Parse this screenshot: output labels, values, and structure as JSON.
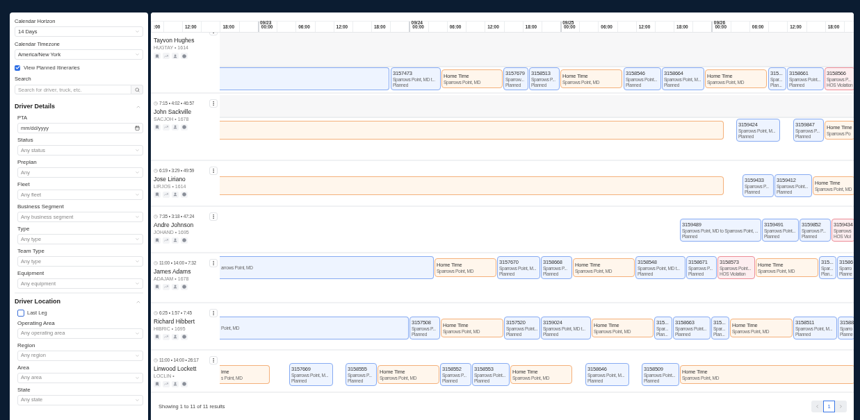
{
  "sidebar": {
    "calendar": [
      {
        "label": "Calendar Horizon",
        "value": "14 Days"
      },
      {
        "label": "Calendar Timezone",
        "value": "America/New York"
      }
    ],
    "view_planned": {
      "label": "View Planned Itineraries",
      "checked": true
    },
    "search": {
      "label": "Search",
      "placeholder": "Search for driver, truck, etc."
    },
    "sections": [
      {
        "title": "Driver Details",
        "expanded": true,
        "fields": [
          {
            "kind": "date",
            "label": "PTA",
            "placeholder": "mm/dd/yyyy"
          },
          {
            "kind": "select",
            "label": "Status",
            "placeholder": "Any status"
          },
          {
            "kind": "select",
            "label": "Preplan",
            "placeholder": "Any"
          },
          {
            "kind": "select",
            "label": "Fleet",
            "placeholder": "Any fleet"
          },
          {
            "kind": "select",
            "label": "Business Segment",
            "placeholder": "Any business segment"
          },
          {
            "kind": "select",
            "label": "Type",
            "placeholder": "Any type"
          },
          {
            "kind": "select",
            "label": "Team Type",
            "placeholder": "Any type"
          },
          {
            "kind": "select",
            "label": "Equipment",
            "placeholder": "Any equipment"
          }
        ]
      },
      {
        "title": "Driver Location",
        "expanded": true,
        "fields": [
          {
            "kind": "checkbox",
            "label": "Last Leg",
            "checked": false
          },
          {
            "kind": "select",
            "label": "Operating Area",
            "placeholder": "Any operating area"
          },
          {
            "kind": "select",
            "label": "Region",
            "placeholder": "Any region"
          },
          {
            "kind": "select",
            "label": "Area",
            "placeholder": "Any area"
          },
          {
            "kind": "select",
            "label": "State",
            "placeholder": "Any state"
          }
        ]
      }
    ]
  },
  "timeline": {
    "dates": [
      "09/23",
      "09/24",
      "09/25",
      "09/26"
    ],
    "hours": [
      ":00",
      "12:00",
      "18:00",
      "00:00",
      "06:00",
      "12:00",
      "18:00",
      "00:00",
      "06:00",
      "12:00",
      "18:00",
      "00:00",
      "06:00",
      "12:00",
      "18:00",
      "00:00",
      "06:00",
      "12:00",
      "18:00"
    ],
    "drivers": [
      {
        "name": "Tayvon Hughes",
        "code": "HUGTAY • 1614",
        "blocks": [
          {
            "kind": "trip"
          },
          {
            "kind": "trip",
            "title": "3157473",
            "detail": "Sparrows Point, MD t...",
            "status": "Planned"
          },
          {
            "kind": "home",
            "title": "Home Time",
            "detail": "Sparrows Point, MD"
          },
          {
            "kind": "trip",
            "title": "3157679",
            "detail": "Sparrow...",
            "status": "Planned"
          },
          {
            "kind": "trip",
            "title": "3158513",
            "detail": "Sparrows P...",
            "status": "Planned"
          },
          {
            "kind": "home",
            "title": "Home Time",
            "detail": "Sparrows Point, MD"
          },
          {
            "kind": "trip",
            "title": "3158546",
            "detail": "Sparrows Point...",
            "status": "Planned"
          },
          {
            "kind": "trip",
            "title": "3158664",
            "detail": "Sparrows Point, M...",
            "status": "Planned"
          },
          {
            "kind": "home",
            "title": "Home Time",
            "detail": "Sparrows Point, MD"
          },
          {
            "kind": "trip",
            "title": "315...",
            "detail": "Spar...",
            "status": "Plan..."
          },
          {
            "kind": "trip",
            "title": "3158661",
            "detail": "Sparrows Point...",
            "status": "Planned"
          },
          {
            "kind": "violation",
            "title": "3158566",
            "detail": "Sparrows P...",
            "status": "HOS Violation"
          }
        ]
      },
      {
        "name": "John Sackville",
        "code": "SACJOH • 1678",
        "meta": "7:15 • 4:02 • 46:57",
        "blocks": [
          {
            "kind": "home"
          },
          {
            "kind": "trip",
            "title": "3159424",
            "detail": "Sparrows Point, M...",
            "status": "Planned"
          },
          {
            "kind": "trip",
            "title": "3159847",
            "detail": "Sparrows P...",
            "status": "Planned"
          },
          {
            "kind": "home",
            "title": "Home Time",
            "detail": "Sparrows Po"
          }
        ]
      },
      {
        "name": "Jose Liriano",
        "code": "LIRJOS • 1614",
        "meta": "6:19 • 3:29 • 49:59",
        "blocks": [
          {
            "kind": "home"
          },
          {
            "kind": "trip",
            "title": "3159433",
            "detail": "Sparrows P...",
            "status": "Planned"
          },
          {
            "kind": "trip",
            "title": "3159412",
            "detail": "Sparrows Point...",
            "status": "Planned"
          },
          {
            "kind": "home",
            "title": "Home Time",
            "detail": "Sparrows Point, MD"
          }
        ]
      },
      {
        "name": "Andre Johnson",
        "code": "JOHAND • 1695",
        "meta": "7:35 • 3:18 • 47:24",
        "blocks": [
          {
            "kind": "trip",
            "title": "3159489",
            "detail": "Sparrows Point, MD to Sparrows Point, ...",
            "status": "Planned"
          },
          {
            "kind": "trip",
            "title": "3159491",
            "detail": "Sparrows Point...",
            "status": "Planned"
          },
          {
            "kind": "trip",
            "title": "3159852",
            "detail": "Sparrows P...",
            "status": "Planned"
          },
          {
            "kind": "violation",
            "title": "3159434",
            "detail": "Sparrows",
            "status": "HOS Viol"
          }
        ]
      },
      {
        "name": "James Adams",
        "code": "ADAJAM • 1678",
        "meta": "11:00 • 14:00 • 7:32",
        "blocks": [
          {
            "kind": "trip",
            "detail": "arrows Point, MD"
          },
          {
            "kind": "home",
            "title": "Home Time",
            "detail": "Sparrows Point, MD"
          },
          {
            "kind": "trip",
            "title": "3157670",
            "detail": "Sparrows Point, M...",
            "status": "Planned"
          },
          {
            "kind": "trip",
            "title": "3158668",
            "detail": "Sparrows P...",
            "status": "Planned"
          },
          {
            "kind": "home",
            "title": "Home Time",
            "detail": "Sparrows Point, MD"
          },
          {
            "kind": "trip",
            "title": "3158548",
            "detail": "Sparrows Point, MD t...",
            "status": "Planned"
          },
          {
            "kind": "trip",
            "title": "3158671",
            "detail": "Sparrows P...",
            "status": "Planned"
          },
          {
            "kind": "violation",
            "title": "3158573",
            "detail": "Sparrows Point...",
            "status": "HOS Violation"
          },
          {
            "kind": "home",
            "title": "Home Time",
            "detail": "Sparrows Point, MD"
          },
          {
            "kind": "trip",
            "title": "315...",
            "detail": "Spar...",
            "status": "Plan..."
          },
          {
            "kind": "trip",
            "title": "31586",
            "detail": "Sparro",
            "status": "Planne"
          }
        ]
      },
      {
        "name": "Richard Hibbert",
        "code": "HIBRIC • 1695",
        "meta": "6:25 • 1:57 • 7:45",
        "blocks": [
          {
            "kind": "trip",
            "detail": "Point, MD"
          },
          {
            "kind": "trip",
            "title": "3157508",
            "detail": "Sparrows P...",
            "status": "Planned"
          },
          {
            "kind": "home",
            "title": "Home Time",
            "detail": "Sparrows Point, MD"
          },
          {
            "kind": "trip",
            "title": "3157520",
            "detail": "Sparrows Point...",
            "status": "Planned"
          },
          {
            "kind": "trip",
            "title": "3159024",
            "detail": "Sparrows Point, MD t...",
            "status": "Planned"
          },
          {
            "kind": "home",
            "title": "Home Time",
            "detail": "Sparrows Point, MD"
          },
          {
            "kind": "trip",
            "title": "315...",
            "detail": "Spar...",
            "status": "Plan..."
          },
          {
            "kind": "trip",
            "title": "3158663",
            "detail": "Sparrows Point...",
            "status": "Planned"
          },
          {
            "kind": "trip",
            "title": "315...",
            "detail": "Spar...",
            "status": "Plan..."
          },
          {
            "kind": "home",
            "title": "Home Time",
            "detail": "Sparrows Point, MD"
          },
          {
            "kind": "trip",
            "title": "3158511",
            "detail": "Sparrows Point, M...",
            "status": "Planned"
          },
          {
            "kind": "trip",
            "title": "31588",
            "detail": "Sparro",
            "status": "Planne"
          }
        ]
      },
      {
        "name": "Linwood Lockett",
        "code": "LOCLIN •",
        "meta": "11:00 • 14:00 • 26:17",
        "blocks": [
          {
            "kind": "home",
            "title": "ime",
            "detail": "s Point, MD"
          },
          {
            "kind": "trip",
            "title": "3157669",
            "detail": "Sparrows Point, M...",
            "status": "Planned"
          },
          {
            "kind": "trip",
            "title": "3158555",
            "detail": "Sparrows P...",
            "status": "Planned"
          },
          {
            "kind": "home",
            "title": "Home Time",
            "detail": "Sparrows Point, MD"
          },
          {
            "kind": "trip",
            "title": "3158552",
            "detail": "Sparrows P...",
            "status": "Planned"
          },
          {
            "kind": "trip",
            "title": "3158553",
            "detail": "Sparrows Point...",
            "status": "Planned"
          },
          {
            "kind": "home",
            "title": "Home Time",
            "detail": "Sparrows Point, MD"
          },
          {
            "kind": "trip",
            "title": "3158646",
            "detail": "Sparrows Point, M...",
            "status": "Planned"
          },
          {
            "kind": "trip",
            "title": "3158509",
            "detail": "Sparrows Point...",
            "status": "Planned"
          },
          {
            "kind": "home",
            "title": "Home Time",
            "detail": "Sparrows Point, MD"
          }
        ]
      }
    ]
  },
  "footer": {
    "summary": "Showing 1 to 11 of 11 results",
    "pages": [
      {
        "label": "1",
        "selected": true
      }
    ]
  }
}
